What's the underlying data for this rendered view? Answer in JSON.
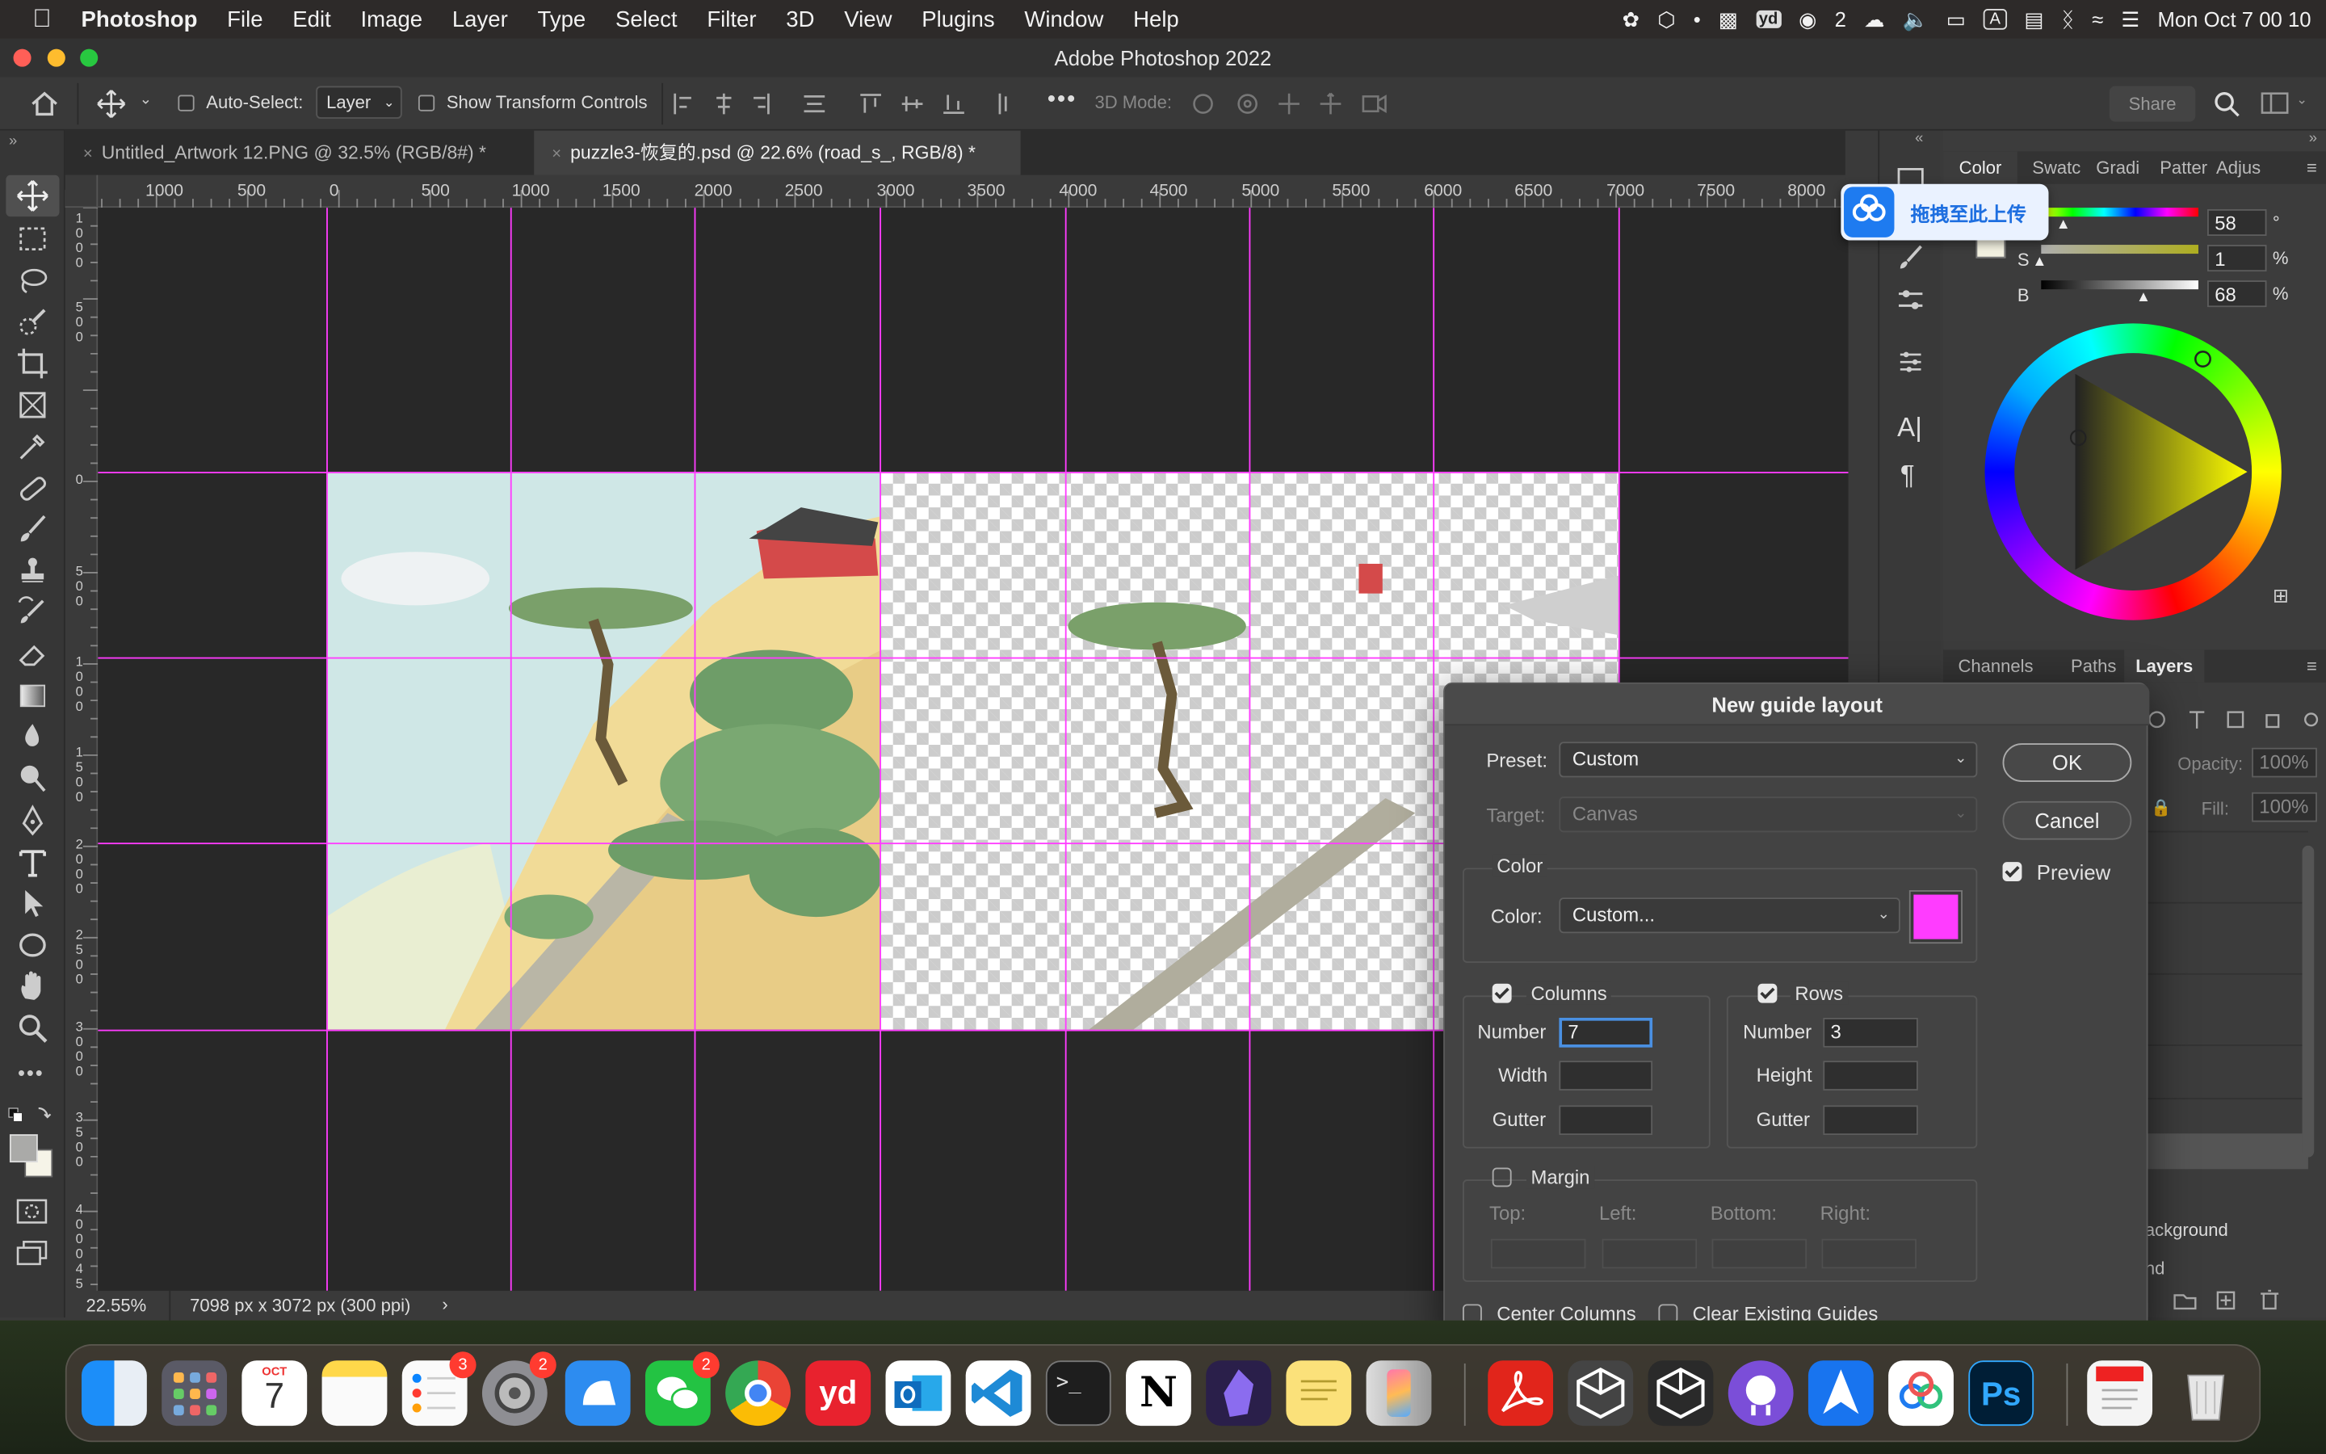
{
  "menubar": {
    "app_name": "Photoshop",
    "items": [
      "File",
      "Edit",
      "Image",
      "Layer",
      "Type",
      "Select",
      "Filter",
      "3D",
      "View",
      "Plugins",
      "Window",
      "Help"
    ],
    "wechat_count": "2",
    "clock": "Mon Oct 7  00 10"
  },
  "window": {
    "title": "Adobe Photoshop 2022"
  },
  "options": {
    "auto_select_label": "Auto-Select:",
    "auto_select_value": "Layer",
    "show_transform_label": "Show Transform Controls",
    "mode_3d_label": "3D Mode:",
    "share_label": "Share"
  },
  "tabs": [
    {
      "label": "Untitled_Artwork 12.PNG @ 32.5% (RGB/8#) *"
    },
    {
      "label": "puzzle3-恢复的.psd @ 22.6% (road_s_, RGB/8) *"
    }
  ],
  "ruler": {
    "h_ticks": [
      "1000",
      "500",
      "0",
      "500",
      "1000",
      "1500",
      "2000",
      "2500",
      "3000",
      "3500",
      "4000",
      "4500",
      "5000",
      "5500",
      "6000",
      "6500",
      "7000",
      "7500",
      "8000"
    ],
    "v_ticks": [
      "1\n0\n0\n0",
      "5\n0\n0",
      "0",
      "5\n0\n0",
      "1\n0\n0\n0",
      "1\n5\n0\n0",
      "2\n0\n0\n0",
      "2\n5\n0\n0",
      "3\n0\n0\n0",
      "3\n5\n0\n0",
      "4\n0\n0\n0",
      "4\n5\n0\n0"
    ]
  },
  "status": {
    "zoom": "22.55%",
    "doc_info": "7098 px x 3072 px (300 ppi)"
  },
  "upload_banner": {
    "text": "拖拽至此上传"
  },
  "color_panel": {
    "tabs": [
      "Color",
      "Swatc",
      "Gradi",
      "Patter",
      "Adjus"
    ],
    "h_value": "58",
    "h_unit": "°",
    "s_label": "S",
    "s_value": "1",
    "s_unit": "%",
    "b_label": "B",
    "b_value": "68",
    "b_unit": "%"
  },
  "layers_panel": {
    "tabs": [
      "Channels",
      "Paths",
      "Layers"
    ],
    "opacity_label": "Opacity:",
    "opacity_value": "100%",
    "fill_label": "Fill:",
    "fill_value": "100%",
    "layer_background": "ackground",
    "layer_last": "nd"
  },
  "dialog": {
    "title": "New guide layout",
    "preset_label": "Preset:",
    "preset_value": "Custom",
    "target_label": "Target:",
    "target_value": "Canvas",
    "color_section": "Color",
    "color_label": "Color:",
    "color_value": "Custom...",
    "swatch_color": "#ff3cff",
    "ok": "OK",
    "cancel": "Cancel",
    "preview": "Preview",
    "columns_label": "Columns",
    "rows_label": "Rows",
    "number_label": "Number",
    "columns_number": "7",
    "rows_number": "3",
    "width_label": "Width",
    "height_label": "Height",
    "gutter_label": "Gutter",
    "margin_label": "Margin",
    "top_label": "Top:",
    "left_label": "Left:",
    "bottom_label": "Bottom:",
    "right_label": "Right:",
    "center_columns": "Center Columns",
    "clear_guides": "Clear Existing Guides"
  },
  "dock": {
    "calendar_month": "OCT",
    "calendar_day": "7",
    "reminders_badge": "3",
    "settings_badge": "2",
    "wechat_badge": "2"
  },
  "colors": {
    "guide": "#ff3cff",
    "accent": "#1473e6"
  }
}
